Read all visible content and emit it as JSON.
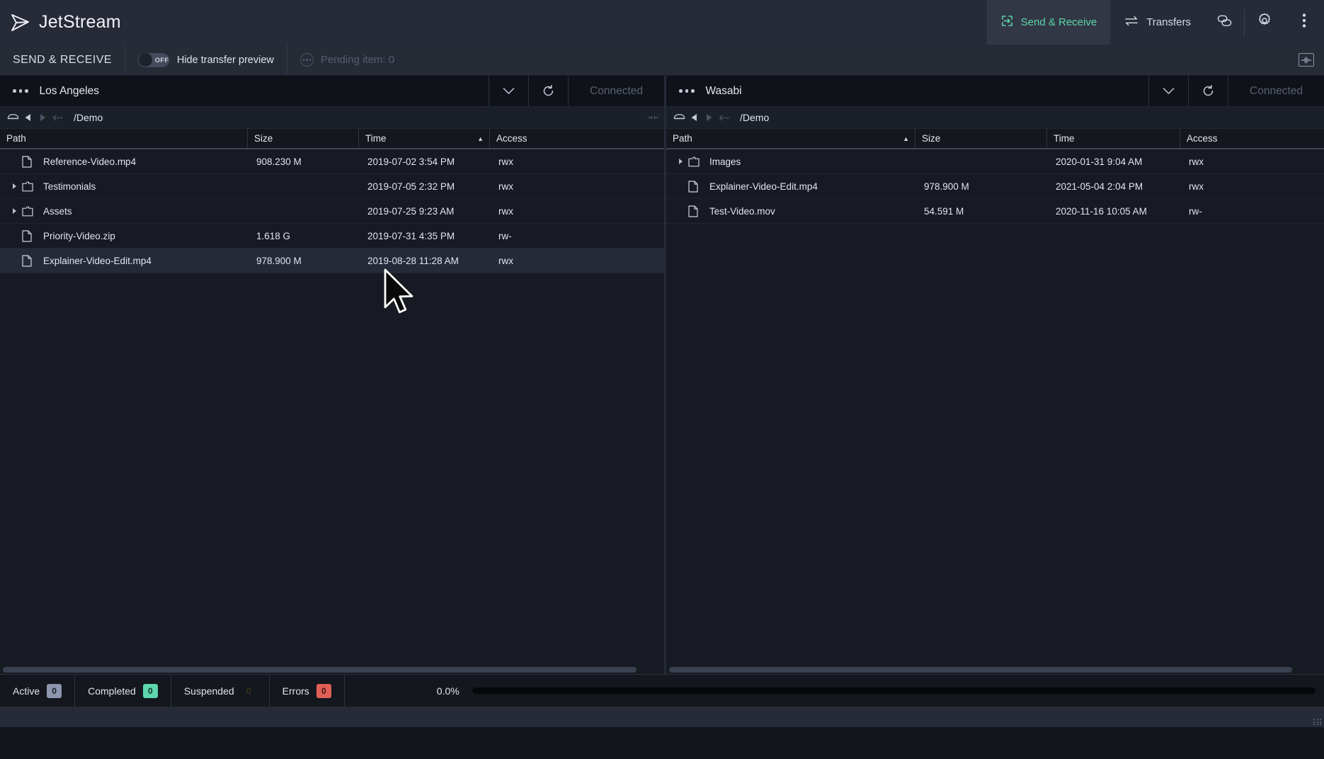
{
  "app": {
    "name": "JetStream",
    "logo_icon": "jetstream-arrow-logo"
  },
  "topnav": {
    "items": [
      {
        "label": "Send & Receive",
        "icon": "send-receive-icon",
        "active": true
      },
      {
        "label": "Transfers",
        "icon": "transfers-arrows-icon",
        "active": false
      }
    ],
    "icon_buttons": [
      {
        "name": "link-icon"
      },
      {
        "name": "gear-icon"
      },
      {
        "name": "more-vertical-icon"
      }
    ],
    "accent_color": "#5dd6ad"
  },
  "subbar": {
    "title": "SEND & RECEIVE",
    "toggle": {
      "label": "Hide transfer preview",
      "state": "OFF"
    },
    "pending": {
      "label": "Pending item: 0",
      "icon": "pending-dots-icon"
    },
    "right_icon": "transfer-preview-panel-icon"
  },
  "panels": [
    {
      "title": "Los Angeles",
      "status": "Connected",
      "path": "/Demo",
      "menu_icon": "more-horizontal-icon",
      "chevron_icon": "chevron-down-icon",
      "refresh_icon": "refresh-icon",
      "drive_icon": "drive-icon",
      "back_icon": "back-arrow-icon",
      "forward_icon": "forward-arrow-icon",
      "up_icon": "up-level-icon",
      "columns": [
        {
          "label": "Path",
          "sort": ""
        },
        {
          "label": "Size",
          "sort": ""
        },
        {
          "label": "Time",
          "sort": "asc"
        },
        {
          "label": "Access",
          "sort": ""
        }
      ],
      "rows": [
        {
          "name": "Reference-Video.mp4",
          "type": "file",
          "expandable": false,
          "size": "908.230 M",
          "time": "2019-07-02 3:54 PM",
          "access": "rwx",
          "hover": false
        },
        {
          "name": "Testimonials",
          "type": "folder",
          "expandable": true,
          "size": "",
          "time": "2019-07-05 2:32 PM",
          "access": "rwx",
          "hover": false
        },
        {
          "name": "Assets",
          "type": "folder",
          "expandable": true,
          "size": "",
          "time": "2019-07-25 9:23 AM",
          "access": "rwx",
          "hover": false
        },
        {
          "name": "Priority-Video.zip",
          "type": "file",
          "expandable": false,
          "size": "1.618 G",
          "time": "2019-07-31 4:35 PM",
          "access": "rw-",
          "hover": false
        },
        {
          "name": "Explainer-Video-Edit.mp4",
          "type": "file",
          "expandable": false,
          "size": "978.900 M",
          "time": "2019-08-28 11:28 AM",
          "access": "rwx",
          "hover": true
        }
      ]
    },
    {
      "title": "Wasabi",
      "status": "Connected",
      "path": "/Demo",
      "menu_icon": "more-horizontal-icon",
      "chevron_icon": "chevron-down-icon",
      "refresh_icon": "refresh-icon",
      "drive_icon": "drive-icon",
      "back_icon": "back-arrow-icon",
      "forward_icon": "forward-arrow-icon",
      "up_icon": "up-level-icon",
      "columns": [
        {
          "label": "Path",
          "sort": "asc"
        },
        {
          "label": "Size",
          "sort": ""
        },
        {
          "label": "Time",
          "sort": ""
        },
        {
          "label": "Access",
          "sort": ""
        }
      ],
      "rows": [
        {
          "name": "Images",
          "type": "folder",
          "expandable": true,
          "size": "",
          "time": "2020-01-31 9:04 AM",
          "access": "rwx",
          "hover": false
        },
        {
          "name": "Explainer-Video-Edit.mp4",
          "type": "file",
          "expandable": false,
          "size": "978.900 M",
          "time": "2021-05-04 2:04 PM",
          "access": "rwx",
          "hover": false
        },
        {
          "name": "Test-Video.mov",
          "type": "file",
          "expandable": false,
          "size": "54.591 M",
          "time": "2020-11-16 10:05 AM",
          "access": "rw-",
          "hover": false
        }
      ]
    }
  ],
  "statusbar": {
    "stats": [
      {
        "label": "Active",
        "count": "0",
        "color": "#8d96ae",
        "text_color": "#1b1f28"
      },
      {
        "label": "Completed",
        "count": "0",
        "color": "#5dd6ad",
        "text_color": "#11332a"
      },
      {
        "label": "Suspended",
        "count": "0",
        "color": "#e3c濃",
        "text_color": "#3a3214"
      },
      {
        "label": "Errors",
        "count": "0",
        "color": "#e06055",
        "text_color": "#3d1612"
      }
    ],
    "progress": {
      "label": "0.0%",
      "value": 0
    }
  }
}
